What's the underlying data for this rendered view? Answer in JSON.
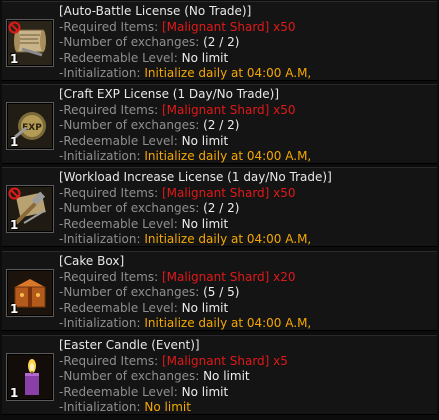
{
  "labels": {
    "required": "-Required Items:",
    "exchanges": "-Number of exchanges:",
    "level": "-Redeemable Level:",
    "init": "-Initialization:"
  },
  "items": [
    {
      "title": "[Auto-Battle License (No Trade)]",
      "required": "[Malignant Shard] x50",
      "exchanges": "(2 / 2)",
      "level": "No limit",
      "init": "Initialize daily at 04:00 A.M,",
      "qty": "1",
      "icon": "scroll-license-icon"
    },
    {
      "title": "[Craft EXP License (1 Day/No Trade)]",
      "required": "[Malignant Shard] x50",
      "exchanges": "(2 / 2)",
      "level": "No limit",
      "init": "Initialize daily at 04:00 A.M,",
      "qty": "1",
      "icon": "exp-coin-icon"
    },
    {
      "title": "[Workload Increase License (1 day/No Trade)]",
      "required": "[Malignant Shard] x50",
      "exchanges": "(2 / 2)",
      "level": "No limit",
      "init": "Initialize daily at 04:00 A.M,",
      "qty": "1",
      "icon": "workload-tools-icon"
    },
    {
      "title": "[Cake Box]",
      "required": "[Malignant Shard] x20",
      "exchanges": "(5 / 5)",
      "level": "No limit",
      "init": "Initialize daily at 04:00 A.M,",
      "qty": "1",
      "icon": "cake-box-icon"
    },
    {
      "title": "[Easter Candle (Event)]",
      "required": "[Malignant Shard] x5",
      "exchanges": "No limit",
      "level": "No limit",
      "init": "No limit",
      "qty": "1",
      "icon": "candle-icon"
    }
  ],
  "colors": {
    "required_text": "#e01919",
    "init_text": "#f5a800",
    "label_text": "#8f8f8f",
    "value_text": "#ededed"
  }
}
